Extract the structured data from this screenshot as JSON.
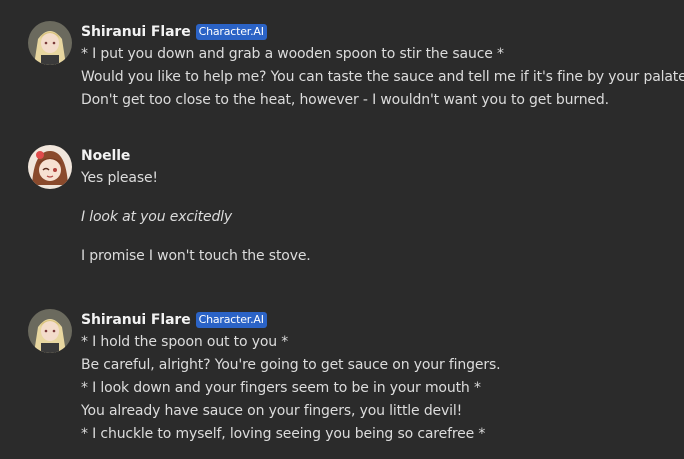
{
  "messages": [
    {
      "author": "Shiranui Flare",
      "badge": "Character.AI",
      "avatar_icon": "anime-girl-blonde-avatar",
      "lines": [
        "* I put you down and grab a wooden spoon to stir the sauce *",
        "Would you like to help me? You can taste the sauce and tell me if it's fine by your palate.",
        "Don't get too close to the heat, however - I wouldn't want you to get burned."
      ]
    },
    {
      "author": "Noelle",
      "avatar_icon": "anime-girl-brown-hair-avatar",
      "lines": [
        "Yes please!",
        "I look at you excitedly",
        "I promise I won't touch the stove."
      ]
    },
    {
      "author": "Shiranui Flare",
      "badge": "Character.AI",
      "avatar_icon": "anime-girl-blonde-avatar",
      "lines": [
        "* I hold the spoon out to you *",
        "Be careful, alright? You're going to get sauce on your fingers.",
        "*  I look down and your fingers seem to be in your mouth *",
        "You already have sauce on your fingers, you little devil!",
        "* I chuckle to myself, loving seeing you being so carefree *"
      ]
    }
  ],
  "colors": {
    "background": "#2b2b2b",
    "badge": "#2b63c6",
    "text": "#dcdcdc"
  }
}
